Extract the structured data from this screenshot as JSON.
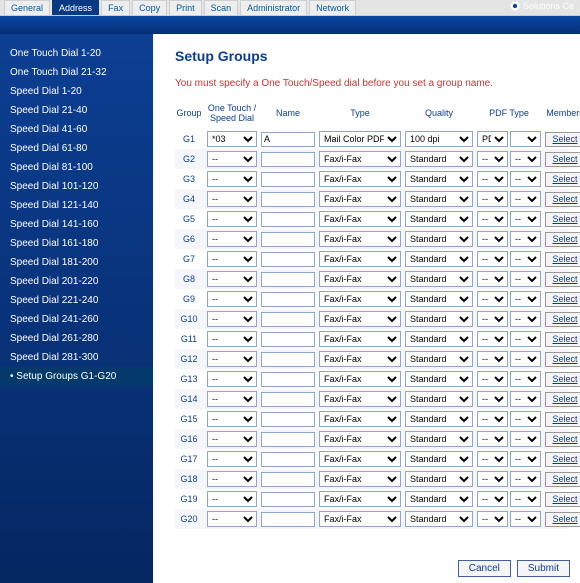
{
  "tabs": [
    "General",
    "Address",
    "Fax",
    "Copy",
    "Print",
    "Scan",
    "Administrator",
    "Network"
  ],
  "active_tab": 1,
  "brand_label": "Solutions Ce",
  "sidebar": {
    "items": [
      "One Touch Dial 1-20",
      "One Touch Dial 21-32",
      "Speed Dial 1-20",
      "Speed Dial 21-40",
      "Speed Dial 41-60",
      "Speed Dial 61-80",
      "Speed Dial 81-100",
      "Speed Dial 101-120",
      "Speed Dial 121-140",
      "Speed Dial 141-160",
      "Speed Dial 161-180",
      "Speed Dial 181-200",
      "Speed Dial 201-220",
      "Speed Dial 221-240",
      "Speed Dial 241-260",
      "Speed Dial 261-280",
      "Speed Dial 281-300",
      "Setup Groups G1-G20"
    ],
    "active_index": 17
  },
  "page": {
    "title": "Setup Groups",
    "hint": "You must specify a One Touch/Speed dial before you set a group name.",
    "columns": [
      "Group",
      "One Touch / Speed Dial",
      "Name",
      "Type",
      "Quality",
      "PDF Type",
      "Members"
    ],
    "select_label": "Select",
    "cancel_label": "Cancel",
    "submit_label": "Submit"
  },
  "rows": [
    {
      "group": "G1",
      "dial": "*03",
      "name": "A",
      "type": "Mail Color PDF",
      "quality": "100 dpi",
      "pdf1": "PDF",
      "pdf2": ""
    },
    {
      "group": "G2",
      "dial": "--",
      "name": "",
      "type": "Fax/i-Fax",
      "quality": "Standard",
      "pdf1": "--",
      "pdf2": "--"
    },
    {
      "group": "G3",
      "dial": "--",
      "name": "",
      "type": "Fax/i-Fax",
      "quality": "Standard",
      "pdf1": "--",
      "pdf2": "--"
    },
    {
      "group": "G4",
      "dial": "--",
      "name": "",
      "type": "Fax/i-Fax",
      "quality": "Standard",
      "pdf1": "--",
      "pdf2": "--"
    },
    {
      "group": "G5",
      "dial": "--",
      "name": "",
      "type": "Fax/i-Fax",
      "quality": "Standard",
      "pdf1": "--",
      "pdf2": "--"
    },
    {
      "group": "G6",
      "dial": "--",
      "name": "",
      "type": "Fax/i-Fax",
      "quality": "Standard",
      "pdf1": "--",
      "pdf2": "--"
    },
    {
      "group": "G7",
      "dial": "--",
      "name": "",
      "type": "Fax/i-Fax",
      "quality": "Standard",
      "pdf1": "--",
      "pdf2": "--"
    },
    {
      "group": "G8",
      "dial": "--",
      "name": "",
      "type": "Fax/i-Fax",
      "quality": "Standard",
      "pdf1": "--",
      "pdf2": "--"
    },
    {
      "group": "G9",
      "dial": "--",
      "name": "",
      "type": "Fax/i-Fax",
      "quality": "Standard",
      "pdf1": "--",
      "pdf2": "--"
    },
    {
      "group": "G10",
      "dial": "--",
      "name": "",
      "type": "Fax/i-Fax",
      "quality": "Standard",
      "pdf1": "--",
      "pdf2": "--"
    },
    {
      "group": "G11",
      "dial": "--",
      "name": "",
      "type": "Fax/i-Fax",
      "quality": "Standard",
      "pdf1": "--",
      "pdf2": "--"
    },
    {
      "group": "G12",
      "dial": "--",
      "name": "",
      "type": "Fax/i-Fax",
      "quality": "Standard",
      "pdf1": "--",
      "pdf2": "--"
    },
    {
      "group": "G13",
      "dial": "--",
      "name": "",
      "type": "Fax/i-Fax",
      "quality": "Standard",
      "pdf1": "--",
      "pdf2": "--"
    },
    {
      "group": "G14",
      "dial": "--",
      "name": "",
      "type": "Fax/i-Fax",
      "quality": "Standard",
      "pdf1": "--",
      "pdf2": "--"
    },
    {
      "group": "G15",
      "dial": "--",
      "name": "",
      "type": "Fax/i-Fax",
      "quality": "Standard",
      "pdf1": "--",
      "pdf2": "--"
    },
    {
      "group": "G16",
      "dial": "--",
      "name": "",
      "type": "Fax/i-Fax",
      "quality": "Standard",
      "pdf1": "--",
      "pdf2": "--"
    },
    {
      "group": "G17",
      "dial": "--",
      "name": "",
      "type": "Fax/i-Fax",
      "quality": "Standard",
      "pdf1": "--",
      "pdf2": "--"
    },
    {
      "group": "G18",
      "dial": "--",
      "name": "",
      "type": "Fax/i-Fax",
      "quality": "Standard",
      "pdf1": "--",
      "pdf2": "--"
    },
    {
      "group": "G19",
      "dial": "--",
      "name": "",
      "type": "Fax/i-Fax",
      "quality": "Standard",
      "pdf1": "--",
      "pdf2": "--"
    },
    {
      "group": "G20",
      "dial": "--",
      "name": "",
      "type": "Fax/i-Fax",
      "quality": "Standard",
      "pdf1": "--",
      "pdf2": "--"
    }
  ]
}
